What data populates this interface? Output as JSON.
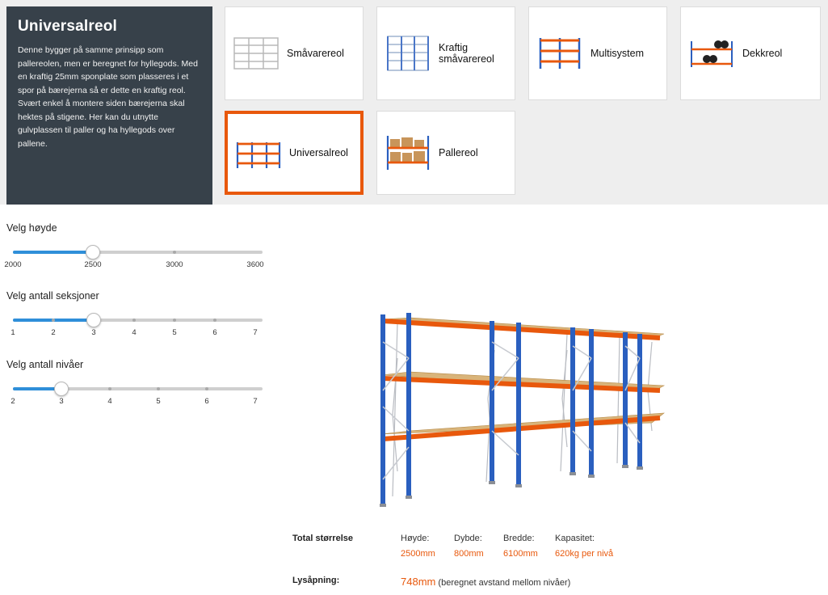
{
  "info": {
    "title": "Universalreol",
    "text": "Denne bygger på samme prinsipp som pallereolen, men er beregnet for hyllegods. Med en kraftig 25mm sponplate som plasseres i et spor på bærejerna så er dette en kraftig reol. Svært enkel å montere siden bærejerna skal hektes på stigene. Her kan du utnytte gulvplassen til paller og ha hyllegods over pallene."
  },
  "types": [
    {
      "label": "Småvarereol",
      "icon": "light-shelving-icon",
      "selected": false
    },
    {
      "label": "Kraftig\nsmåvarereol",
      "icon": "heavy-shelving-icon",
      "selected": false
    },
    {
      "label": "Multisystem",
      "icon": "multisystem-rack-icon",
      "selected": false
    },
    {
      "label": "Dekkreol",
      "icon": "tire-rack-icon",
      "selected": false
    },
    {
      "label": "Universalreol",
      "icon": "universal-rack-icon",
      "selected": true
    },
    {
      "label": "Pallereol",
      "icon": "pallet-rack-icon",
      "selected": false
    }
  ],
  "sliders": {
    "height": {
      "label": "Velg høyde",
      "ticks": [
        "2000",
        "2500",
        "3000",
        "3600"
      ],
      "selected_index": 1
    },
    "sections": {
      "label": "Velg antall seksjoner",
      "ticks": [
        "1",
        "2",
        "3",
        "4",
        "5",
        "6",
        "7"
      ],
      "selected_index": 2
    },
    "levels": {
      "label": "Velg antall nivåer",
      "ticks": [
        "2",
        "3",
        "4",
        "5",
        "6",
        "7"
      ],
      "selected_index": 1
    }
  },
  "specs": {
    "total_label": "Total størrelse",
    "height_label": "Høyde:",
    "height_value": "2500mm",
    "depth_label": "Dybde:",
    "depth_value": "800mm",
    "width_label": "Bredde:",
    "width_value": "6100mm",
    "capacity_label": "Kapasitet:",
    "capacity_value": "620kg per nivå",
    "clearance_label": "Lysåpning:",
    "clearance_value": "748mm",
    "clearance_note": "(beregnet avstand mellom nivåer)"
  },
  "colors": {
    "accent": "#e8580c",
    "panel": "#37414a",
    "slider_fill": "#2f8fd9",
    "upright_blue": "#2a5fbf",
    "beam_orange": "#e8580c"
  }
}
